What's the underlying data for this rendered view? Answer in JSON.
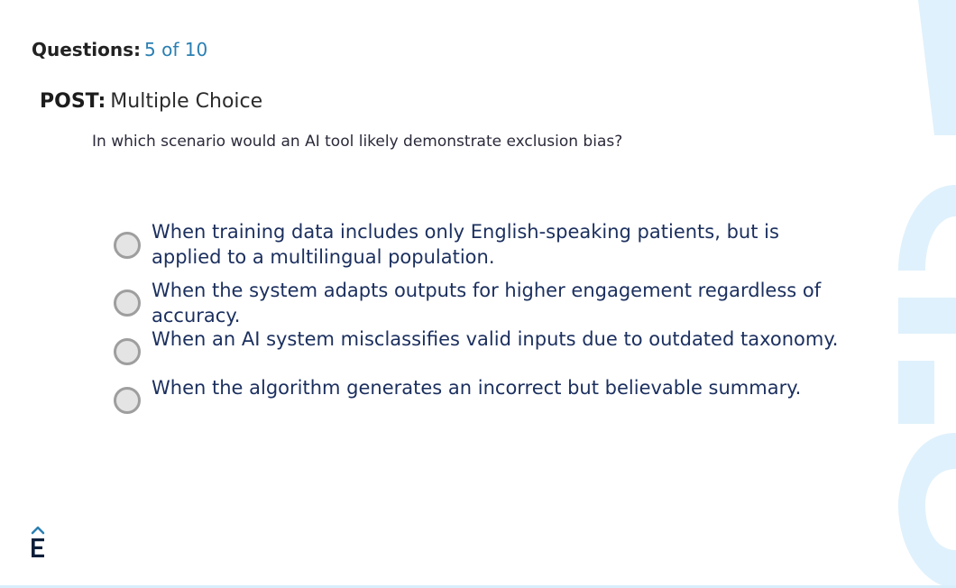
{
  "quiz": {
    "counter_label": "Questions:",
    "counter_value": "5 of 10",
    "type_label": "POST:",
    "type_value": "Multiple Choice",
    "question": "In which scenario would an AI tool likely demonstrate exclusion bias?",
    "options": [
      {
        "label": "When training data includes only English-speaking patients, but is applied to a multilingual population.",
        "selected": false
      },
      {
        "label": "When the system adapts outputs for higher engagement regardless of accuracy.",
        "selected": false
      },
      {
        "label": "When an AI system misclassifies valid inputs due to outdated taxonomy.",
        "selected": false
      },
      {
        "label": "When the algorithm generates an incorrect but believable summary.",
        "selected": false
      }
    ]
  },
  "logo": {
    "icon": "e-logo-icon",
    "color": "#0b1f3a"
  },
  "colors": {
    "accent": "#2a7fb3",
    "option_text": "#1b2f5e",
    "decoration": "#dff1fc"
  }
}
